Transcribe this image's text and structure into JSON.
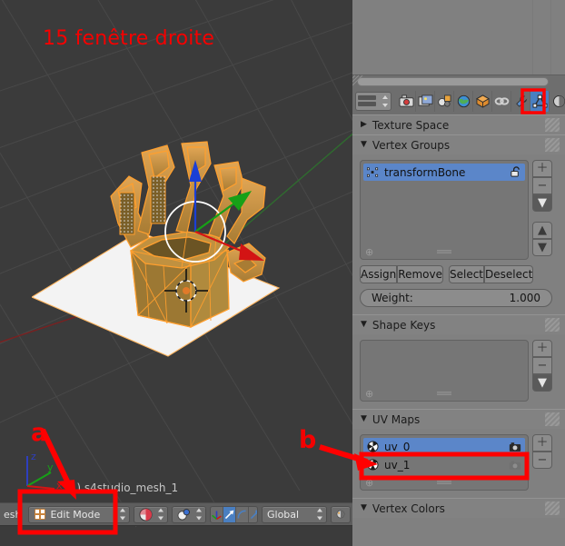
{
  "viewport": {
    "annotation_title": "15 fenêtre droite",
    "object_name": "(1) s4studio_mesh_1",
    "annotation_a": "a",
    "axis_labels": {
      "x": "x",
      "y": "y",
      "z": "z"
    },
    "header": {
      "menu_text": "esh",
      "mode_label": "Edit Mode",
      "mode_icon": "edit-mode-icon",
      "shading_icon": "shading-solid-icon",
      "pivot_icon": "pivot-median-icon",
      "manipulator_icons": [
        "manipulator-toggle-icon",
        "translate-icon",
        "rotate-icon",
        "scale-icon"
      ],
      "orientation_label": "Global",
      "layers_icon": "layers-icon"
    }
  },
  "properties": {
    "annotation_b": "b",
    "tabs": [
      {
        "name": "render-tab",
        "icon": "camera-icon",
        "active": false
      },
      {
        "name": "render-layers-tab",
        "icon": "images-icon",
        "active": false
      },
      {
        "name": "scene-tab",
        "icon": "scene-icon",
        "active": false
      },
      {
        "name": "world-tab",
        "icon": "world-globe-icon",
        "active": false
      },
      {
        "name": "object-tab",
        "icon": "cube-icon",
        "active": false
      },
      {
        "name": "constraints-tab",
        "icon": "chain-link-icon",
        "active": false
      },
      {
        "name": "modifiers-tab",
        "icon": "wrench-icon",
        "active": false
      },
      {
        "name": "object-data-tab",
        "icon": "mesh-data-triangle-icon",
        "active": true
      },
      {
        "name": "material-tab",
        "icon": "material-sphere-icon",
        "active": false
      },
      {
        "name": "texture-tab",
        "icon": "texture-checker-icon",
        "active": false
      }
    ],
    "panels": [
      {
        "title": "Texture Space",
        "expanded": false
      },
      {
        "title": "Vertex Groups",
        "expanded": true
      },
      {
        "title": "Shape Keys",
        "expanded": true
      },
      {
        "title": "UV Maps",
        "expanded": true
      },
      {
        "title": "Vertex Colors",
        "expanded": true
      }
    ],
    "vertex_groups": {
      "title": "Vertex Groups",
      "items": [
        {
          "label": "transformBone",
          "selected": true,
          "lock_icon": "unlocked-padlock-icon"
        }
      ],
      "buttons": {
        "assign": "Assign",
        "remove": "Remove",
        "select": "Select",
        "deselect": "Deselect"
      },
      "weight_label": "Weight:",
      "weight_value": "1.000",
      "side_buttons": [
        "add-icon",
        "remove-icon",
        "specials-dropdown-icon",
        "move-up-icon",
        "move-down-icon"
      ]
    },
    "shape_keys": {
      "title": "Shape Keys",
      "items": [],
      "side_buttons": [
        "add-icon",
        "remove-icon",
        "specials-dropdown-icon"
      ]
    },
    "uv_maps": {
      "title": "UV Maps",
      "items": [
        {
          "label": "uv_0",
          "selected": true,
          "icon": "uv-group-icon",
          "render_icon": "camera-active-icon"
        },
        {
          "label": "uv_1",
          "selected": false,
          "icon": "uv-group-icon",
          "render_icon": "camera-inactive-icon"
        }
      ],
      "side_buttons": [
        "add-icon",
        "remove-icon"
      ]
    },
    "vertex_colors": {
      "title": "Vertex Colors"
    }
  },
  "colors": {
    "annotation_red": "#ff0000",
    "selection_blue": "#5b86c9",
    "active_tab_blue": "#4a7fc1",
    "panel_gray": "#808080",
    "viewport_gray": "#3b3b3b",
    "mesh_orange": "#ff9f2e"
  }
}
